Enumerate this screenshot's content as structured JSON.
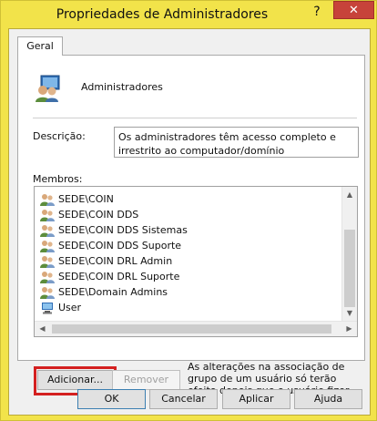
{
  "window": {
    "title": "Propriedades de Administradores",
    "help_glyph": "?",
    "close_glyph": "✕"
  },
  "tabs": [
    {
      "label": "Geral",
      "selected": true
    }
  ],
  "group": {
    "icon": "user-group-icon",
    "name": "Administradores"
  },
  "description": {
    "label": "Descrição:",
    "value": "Os administradores têm acesso completo e irrestrito ao computador/domínio"
  },
  "members": {
    "label": "Membros:",
    "items": [
      {
        "name": "SEDE\\COIN",
        "icon": "group-icon"
      },
      {
        "name": "SEDE\\COIN DDS",
        "icon": "group-icon"
      },
      {
        "name": "SEDE\\COIN DDS Sistemas",
        "icon": "group-icon"
      },
      {
        "name": "SEDE\\COIN DDS Suporte",
        "icon": "group-icon"
      },
      {
        "name": "SEDE\\COIN DRL Admin",
        "icon": "group-icon"
      },
      {
        "name": "SEDE\\COIN DRL Suporte",
        "icon": "group-icon"
      },
      {
        "name": "SEDE\\Domain Admins",
        "icon": "group-icon"
      },
      {
        "name": "User",
        "icon": "computer-user-icon"
      }
    ]
  },
  "buttons": {
    "add": "Adicionar...",
    "remove": "Remover",
    "ok": "OK",
    "cancel": "Cancelar",
    "apply": "Aplicar",
    "help": "Ajuda"
  },
  "note": "As alterações na associação de grupo de um usuário só terão efeito depois que o usuário fizer logon."
}
